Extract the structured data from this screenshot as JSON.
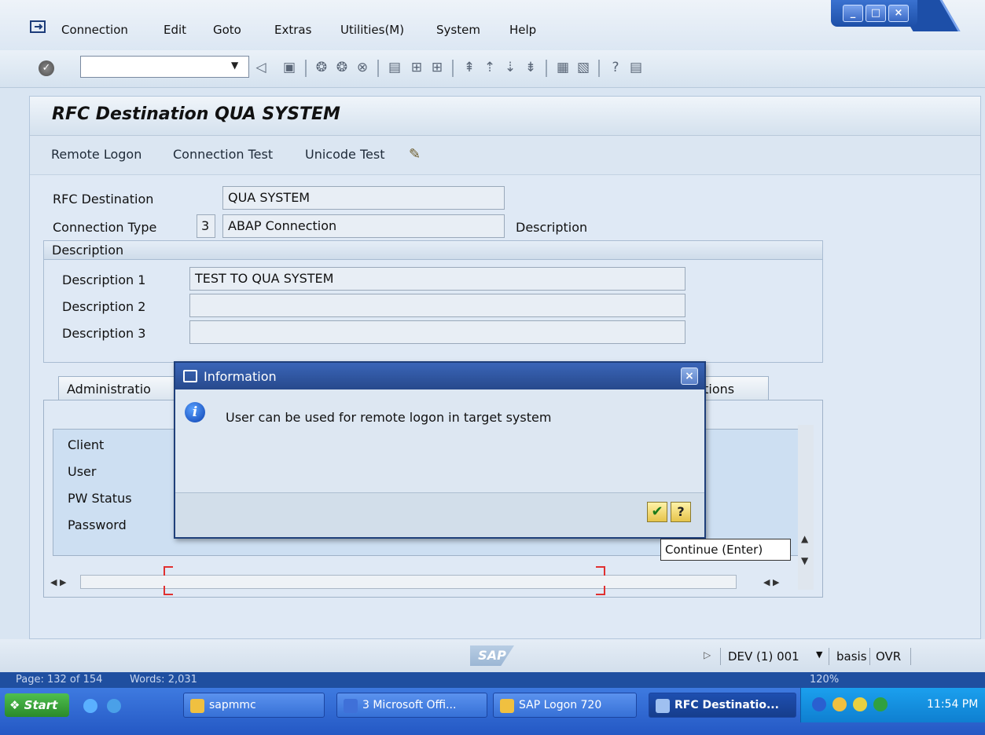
{
  "menubar": {
    "items": [
      {
        "label": "Connection"
      },
      {
        "label": "Edit"
      },
      {
        "label": "Goto"
      },
      {
        "label": "Extras"
      },
      {
        "label": "Utilities(M)"
      },
      {
        "label": "System"
      },
      {
        "label": "Help"
      }
    ]
  },
  "window": {
    "minimize": "_",
    "maximize": "□",
    "close": "×"
  },
  "toolbar": {
    "command_value": ""
  },
  "page": {
    "title": "RFC Destination QUA SYSTEM"
  },
  "app_toolbar": {
    "remote_logon": "Remote Logon",
    "connection_test": "Connection Test",
    "unicode_test": "Unicode Test"
  },
  "form": {
    "rfc_destination_label": "RFC Destination",
    "rfc_destination_value": "QUA SYSTEM",
    "connection_type_label": "Connection Type",
    "connection_type_code": "3",
    "connection_type_value": "ABAP Connection",
    "description_label": "Description"
  },
  "description_group": {
    "header": "Description",
    "rows": [
      {
        "label": "Description 1",
        "value": "TEST TO QUA SYSTEM"
      },
      {
        "label": "Description 2",
        "value": ""
      },
      {
        "label": "Description 3",
        "value": ""
      }
    ]
  },
  "tabs": {
    "administration": "Administratio",
    "options": "ptions"
  },
  "logon_fields": [
    "Client",
    "User",
    "PW Status",
    "Password"
  ],
  "dialog": {
    "title": "Information",
    "message": "User can be used for remote logon in target system",
    "close": "×"
  },
  "tooltip": {
    "text": "Continue   (Enter)"
  },
  "statusbar": {
    "logo": "SAP",
    "system": "DEV (1) 001",
    "user": "basis",
    "mode": "OVR"
  },
  "word_strip": {
    "page": "Page: 132 of 154",
    "words": "Words: 2,031",
    "zoom": "120%"
  },
  "taskbar": {
    "start": "Start",
    "items": [
      {
        "label": "sapmmc"
      },
      {
        "label": "3 Microsoft Offi..."
      },
      {
        "label": "SAP Logon 720"
      },
      {
        "label": "RFC Destinatio..."
      }
    ],
    "time": "11:54 PM"
  },
  "colors": {
    "accent": "#27498c",
    "panel": "#dfe9f5",
    "taskbar": "#2458c4"
  }
}
